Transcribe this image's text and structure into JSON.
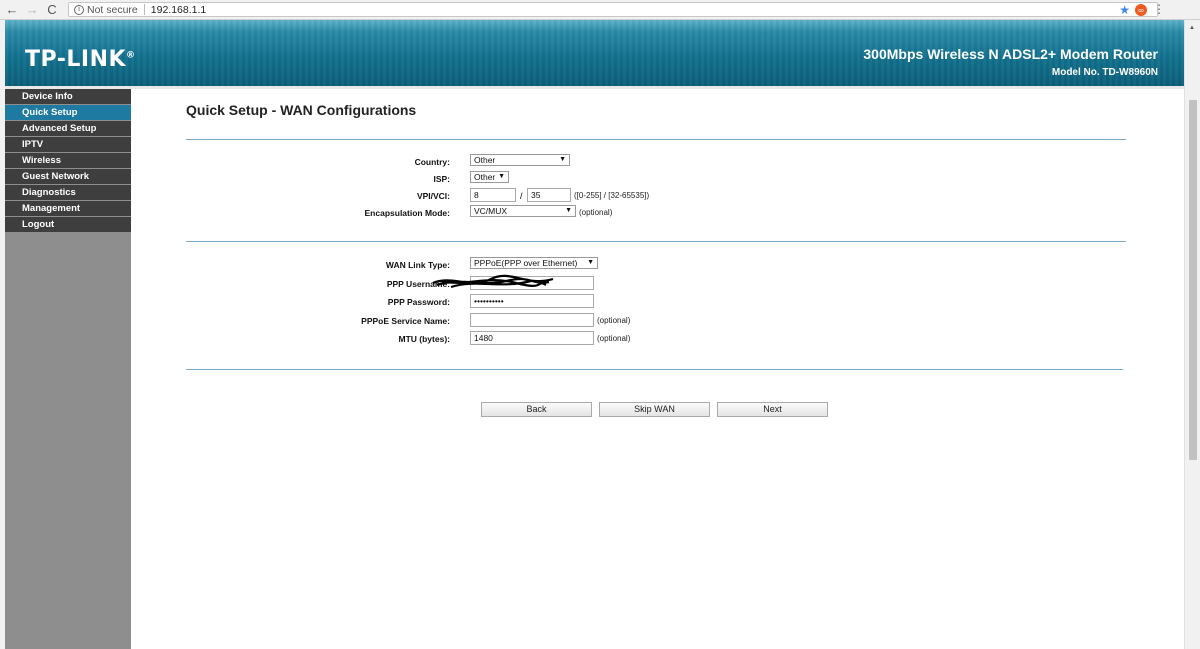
{
  "browser": {
    "back_icon": "←",
    "forward_icon": "→",
    "reload_icon": "C",
    "secure_label": "Not secure",
    "url": "192.168.1.1"
  },
  "header": {
    "logo": "TP-LINK",
    "logo_mark": "®",
    "product": "300Mbps Wireless N ADSL2+ Modem Router",
    "model": "Model No. TD-W8960N"
  },
  "sidebar": {
    "items": [
      {
        "label": "Device Info",
        "active": false
      },
      {
        "label": "Quick Setup",
        "active": true
      },
      {
        "label": "Advanced Setup",
        "active": false
      },
      {
        "label": "IPTV",
        "active": false
      },
      {
        "label": "Wireless",
        "active": false
      },
      {
        "label": "Guest Network",
        "active": false
      },
      {
        "label": "Diagnostics",
        "active": false
      },
      {
        "label": "Management",
        "active": false
      },
      {
        "label": "Logout",
        "active": false
      }
    ]
  },
  "page": {
    "title": "Quick Setup - WAN Configurations"
  },
  "form1": {
    "country_label": "Country:",
    "country_value": "Other",
    "isp_label": "ISP:",
    "isp_value": "Other",
    "vpivci_label": "VPI/VCI:",
    "vpi_value": "8",
    "vci_value": "35",
    "vpivci_sep": "/",
    "vpivci_hint": "([0-255] / [32-65535])",
    "encap_label": "Encapsulation Mode:",
    "encap_value": "VC/MUX",
    "encap_hint": "(optional)"
  },
  "form2": {
    "wan_link_label": "WAN Link Type:",
    "wan_link_value": "PPPoE(PPP over Ethernet)",
    "ppp_user_label": "PPP Username:",
    "ppp_user_value": "",
    "ppp_pass_label": "PPP Password:",
    "ppp_pass_value": "••••••••••",
    "service_label": "PPPoE Service Name:",
    "service_value": "",
    "service_hint": "(optional)",
    "mtu_label": "MTU (bytes):",
    "mtu_value": "1480",
    "mtu_hint": "(optional)"
  },
  "buttons": {
    "back": "Back",
    "skip": "Skip WAN",
    "next": "Next"
  }
}
